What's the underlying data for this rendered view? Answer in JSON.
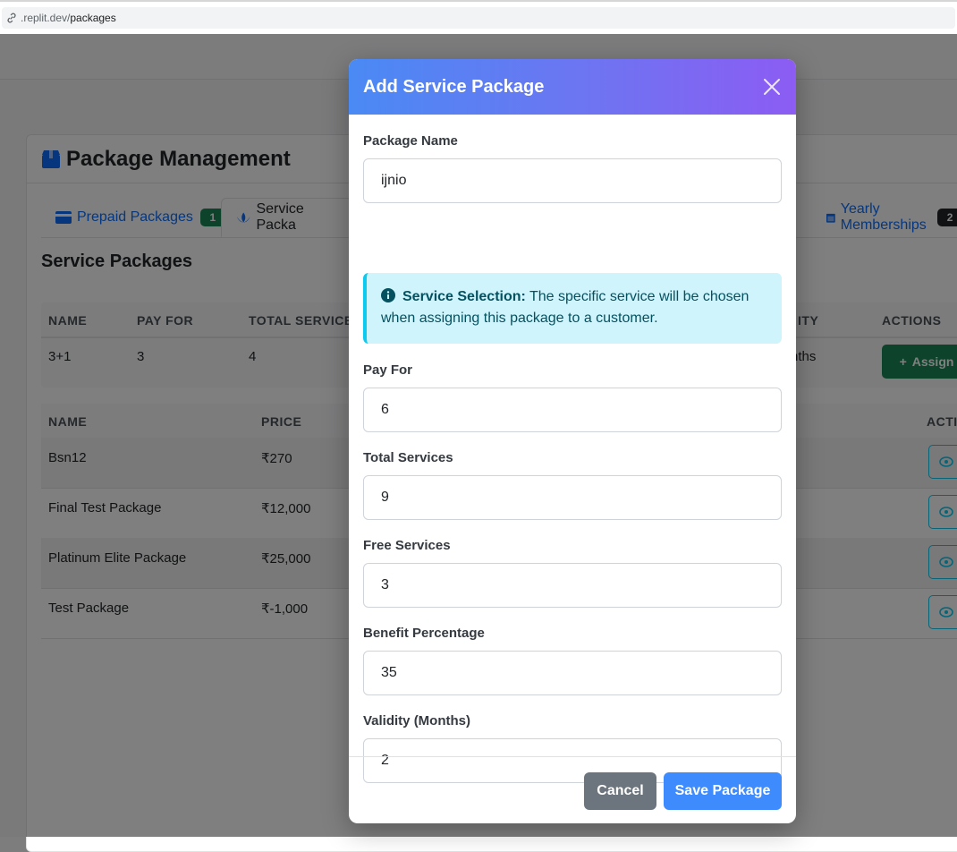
{
  "browser": {
    "url_prefix": ".replit.dev/",
    "url_path": "packages"
  },
  "page": {
    "title": "Package Management",
    "tabs": [
      {
        "label": "Prepaid Packages",
        "badge": "1"
      },
      {
        "label": "Service Packa"
      },
      {
        "label": "Yearly Memberships",
        "badge": "2"
      }
    ],
    "section_title": "Service Packages",
    "table1": {
      "headers": [
        "NAME",
        "PAY FOR",
        "TOTAL SERVICES",
        "ITY",
        "ACTIONS"
      ],
      "row": {
        "name": "3+1",
        "pay_for": "3",
        "total": "4",
        "validity": "nths",
        "action": "Assign"
      }
    },
    "table2": {
      "headers": [
        "NAME",
        "PRICE",
        "ACTI"
      ],
      "rows": [
        {
          "name": "Bsn12",
          "price": "₹270"
        },
        {
          "name": "Final Test Package",
          "price": "₹12,000"
        },
        {
          "name": "Platinum Elite Package",
          "price": "₹25,000"
        },
        {
          "name": "Test Package",
          "price": "₹-1,000"
        }
      ]
    }
  },
  "modal": {
    "title": "Add Service Package",
    "fields": {
      "package_name": {
        "label": "Package Name",
        "value": "ijnio"
      },
      "pay_for": {
        "label": "Pay For",
        "value": "6"
      },
      "total_services": {
        "label": "Total Services",
        "value": "9"
      },
      "free_services": {
        "label": "Free Services",
        "value": "3"
      },
      "benefit_percentage": {
        "label": "Benefit Percentage",
        "value": "35"
      },
      "validity": {
        "label": "Validity (Months)",
        "value": "2"
      }
    },
    "alert": {
      "bold": "Service Selection:",
      "text": " The specific service will be chosen when assigning this package to a customer."
    },
    "cancel_label": "Cancel",
    "save_label": "Save Package"
  },
  "colors": {
    "header_gradient_start": "#4a8af4",
    "header_gradient_end": "#8c5cf3",
    "save_button": "#3d8bfd",
    "cancel_button": "#6c757d",
    "alert_bg": "#cff4fc",
    "alert_border": "#0dcaf0"
  }
}
